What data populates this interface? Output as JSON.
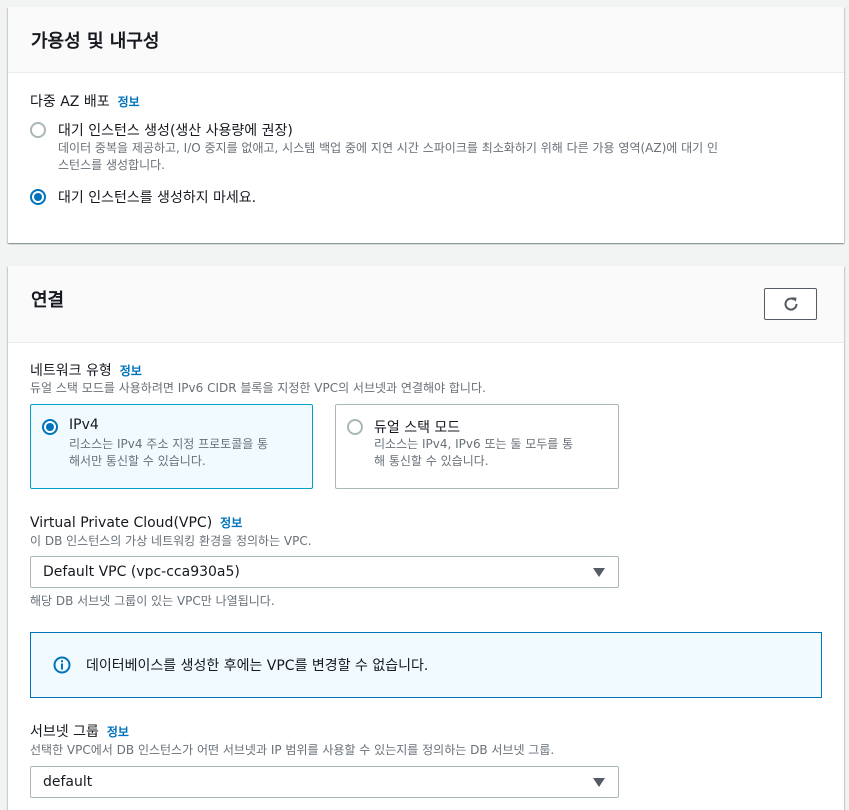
{
  "availability": {
    "title": "가용성 및 내구성",
    "multi_az_label": "다중 AZ 배포",
    "info_link": "정보",
    "options": [
      {
        "label": "대기 인스턴스 생성(생산 사용량에 권장)",
        "description_line1": "데이터 중복을 제공하고, I/O 중지를 없애고, 시스템 백업 중에 지연 시간 스파이크를 최소화하기 위해 다른 가용 영역(AZ)에 대기 인",
        "description_line2": "스턴스를 생성합니다.",
        "selected": false
      },
      {
        "label": "대기 인스턴스를 생성하지 마세요.",
        "selected": true
      }
    ]
  },
  "connectivity": {
    "title": "연결",
    "refresh_icon": "refresh-icon",
    "network_type": {
      "label": "네트워크 유형",
      "info_link": "정보",
      "description": "듀얼 스택 모드를 사용하려면 IPv6 CIDR 블록을 지정한 VPC의 서브넷과 연결해야 합니다.",
      "tiles": [
        {
          "title": "IPv4",
          "description_line1": "리소스는 IPv4 주소 지정 프로토콜을 통",
          "description_line2": "해서만 통신할 수 있습니다.",
          "selected": true
        },
        {
          "title": "듀얼 스택 모드",
          "description_line1": "리소스는 IPv4, IPv6 또는 둘 모두를 통",
          "description_line2": "해 통신할 수 있습니다.",
          "selected": false
        }
      ]
    },
    "vpc": {
      "label": "Virtual Private Cloud(VPC)",
      "info_link": "정보",
      "description": "이 DB 인스턴스의 가상 네트워킹 환경을 정의하는 VPC.",
      "selected_value": "Default VPC (vpc-cca930a5)",
      "hint": "해당 DB 서브넷 그룹이 있는 VPC만 나열됩니다."
    },
    "alert": {
      "icon": "info-circle-icon",
      "text": "데이터베이스를 생성한 후에는 VPC를 변경할 수 없습니다."
    },
    "subnet_group": {
      "label": "서브넷 그룹",
      "info_link": "정보",
      "description": "선택한 VPC에서 DB 인스턴스가 어떤 서브넷과 IP 범위를 사용할 수 있는지를 정의하는 DB 서브넷 그룹.",
      "selected_value": "default"
    }
  },
  "colors": {
    "accent": "#0073bb",
    "tile_selected_border": "#00a1c9",
    "tile_selected_bg": "#f1faff",
    "page_bg": "#f2f3f3"
  }
}
